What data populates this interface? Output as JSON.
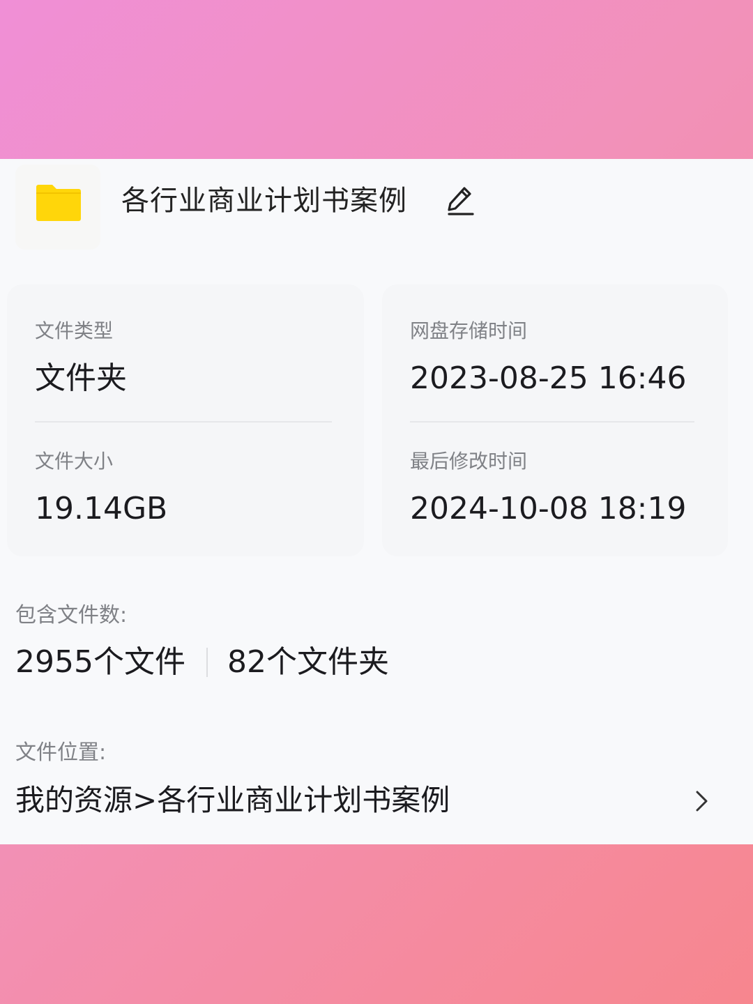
{
  "folder": {
    "name": "各行业商业计划书案例",
    "icon": "folder-icon",
    "icon_color": "#ffd60a"
  },
  "details": {
    "type_label": "文件类型",
    "type_value": "文件夹",
    "size_label": "文件大小",
    "size_value": "19.14GB",
    "stored_label": "网盘存储时间",
    "stored_value": "2023-08-25 16:46",
    "modified_label": "最后修改时间",
    "modified_value": "2024-10-08 18:19"
  },
  "contents": {
    "label": "包含文件数:",
    "files": "2955个文件",
    "folders": "82个文件夹"
  },
  "location": {
    "label": "文件位置:",
    "path": "我的资源>各行业商业计划书案例"
  }
}
